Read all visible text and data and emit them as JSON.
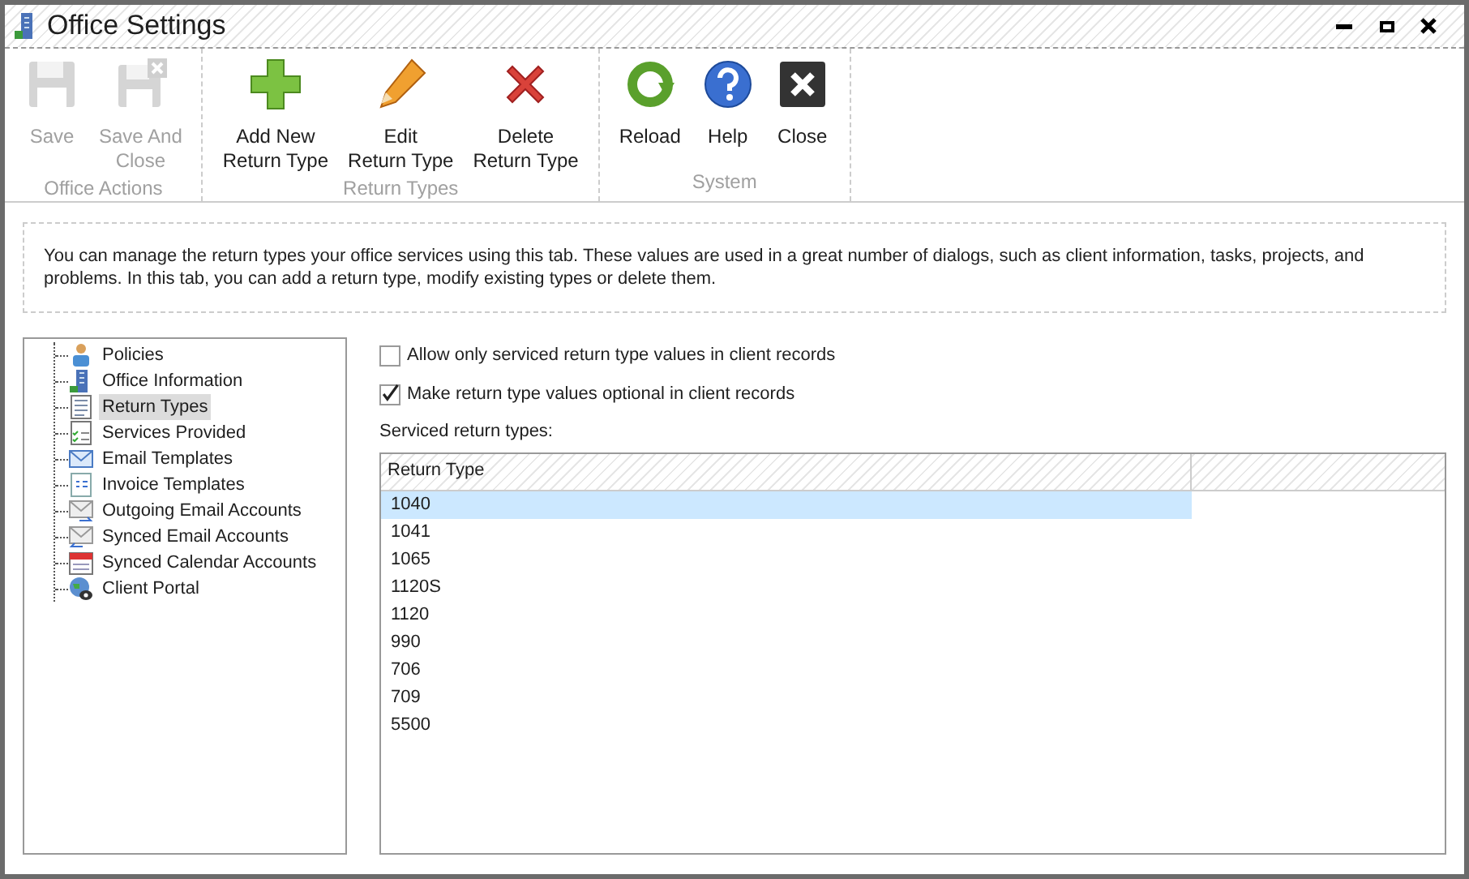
{
  "window": {
    "title": "Office Settings"
  },
  "toolbar": {
    "groups": [
      {
        "label": "Office Actions",
        "buttons": [
          {
            "kind": "save",
            "lines": [
              "Save"
            ],
            "disabled": true
          },
          {
            "kind": "save-close",
            "lines": [
              "Save And",
              "Close"
            ],
            "disabled": true
          }
        ]
      },
      {
        "label": "Return Types",
        "buttons": [
          {
            "kind": "add",
            "lines": [
              "Add New",
              "Return Type"
            ],
            "disabled": false
          },
          {
            "kind": "edit",
            "lines": [
              "Edit",
              "Return Type"
            ],
            "disabled": false
          },
          {
            "kind": "delete",
            "lines": [
              "Delete",
              "Return Type"
            ],
            "disabled": false
          }
        ]
      },
      {
        "label": "System",
        "buttons": [
          {
            "kind": "reload",
            "lines": [
              "Reload"
            ],
            "disabled": false
          },
          {
            "kind": "help",
            "lines": [
              "Help"
            ],
            "disabled": false
          },
          {
            "kind": "close",
            "lines": [
              "Close"
            ],
            "disabled": false
          }
        ]
      }
    ]
  },
  "description": "You can manage the return types your office services using this tab. These values are used in a great number of dialogs, such as client information, tasks, projects, and problems. In this tab, you can add a return type, modify existing types or delete them.",
  "sidebar": {
    "items": [
      {
        "kind": "people",
        "label": "Policies",
        "selected": false
      },
      {
        "kind": "building",
        "label": "Office Information",
        "selected": false
      },
      {
        "kind": "list",
        "label": "Return Types",
        "selected": true
      },
      {
        "kind": "checklist",
        "label": "Services Provided",
        "selected": false
      },
      {
        "kind": "mail",
        "label": "Email Templates",
        "selected": false
      },
      {
        "kind": "invoice",
        "label": "Invoice Templates",
        "selected": false
      },
      {
        "kind": "mail-out",
        "label": "Outgoing Email Accounts",
        "selected": false
      },
      {
        "kind": "mail-in",
        "label": "Synced Email Accounts",
        "selected": false
      },
      {
        "kind": "calendar",
        "label": "Synced Calendar Accounts",
        "selected": false
      },
      {
        "kind": "globe",
        "label": "Client Portal",
        "selected": false
      }
    ]
  },
  "options": [
    {
      "label": "Allow only serviced return type values in client records",
      "checked": false
    },
    {
      "label": "Make return type values optional in client records",
      "checked": true
    }
  ],
  "list_label": "Serviced return types:",
  "table": {
    "columns": [
      "Return Type"
    ],
    "rows": [
      {
        "value": "1040",
        "selected": true
      },
      {
        "value": "1041",
        "selected": false
      },
      {
        "value": "1065",
        "selected": false
      },
      {
        "value": "1120S",
        "selected": false
      },
      {
        "value": "1120",
        "selected": false
      },
      {
        "value": "990",
        "selected": false
      },
      {
        "value": "706",
        "selected": false
      },
      {
        "value": "709",
        "selected": false
      },
      {
        "value": "5500",
        "selected": false
      }
    ]
  }
}
